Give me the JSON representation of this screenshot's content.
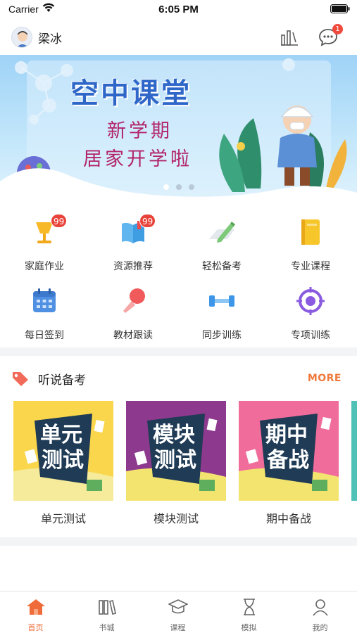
{
  "status_bar": {
    "carrier": "Carrier",
    "time": "6:05 PM"
  },
  "header": {
    "user_name": "梁冰",
    "message_badge": "1"
  },
  "banner": {
    "title": "空中课堂",
    "line1": "新学期",
    "line2": "居家开学啦",
    "slides": 3,
    "active_slide": 0
  },
  "features": [
    {
      "label": "家庭作业",
      "icon": "lamp-icon",
      "badge": "99"
    },
    {
      "label": "资源推荐",
      "icon": "open-book-icon",
      "badge": "99"
    },
    {
      "label": "轻松备考",
      "icon": "pencil-paper-icon"
    },
    {
      "label": "专业课程",
      "icon": "notebook-icon"
    },
    {
      "label": "每日签到",
      "icon": "calendar-icon"
    },
    {
      "label": "教材跟读",
      "icon": "microphone-icon"
    },
    {
      "label": "同步训练",
      "icon": "dumbbell-icon"
    },
    {
      "label": "专项训练",
      "icon": "target-icon"
    }
  ],
  "section": {
    "title": "听说备考",
    "more": "MORE",
    "cards": [
      {
        "label": "单元测试",
        "art_line1": "单元",
        "art_line2": "测试",
        "color": "#f9d64c"
      },
      {
        "label": "模块测试",
        "art_line1": "模块",
        "art_line2": "测试",
        "color": "#8d3a8e"
      },
      {
        "label": "期中备战",
        "art_line1": "期中",
        "art_line2": "备战",
        "color": "#f06c9b"
      }
    ]
  },
  "tabbar": {
    "tabs": [
      {
        "label": "首页",
        "icon": "home-icon"
      },
      {
        "label": "书城",
        "icon": "books-icon"
      },
      {
        "label": "课程",
        "icon": "graduation-cap-icon"
      },
      {
        "label": "模拟",
        "icon": "hourglass-icon"
      },
      {
        "label": "我的",
        "icon": "user-icon"
      }
    ],
    "active": 0
  },
  "colors": {
    "accent": "#ef6b3a",
    "badge": "#e8433a",
    "banner_title": "#2f67c9"
  }
}
